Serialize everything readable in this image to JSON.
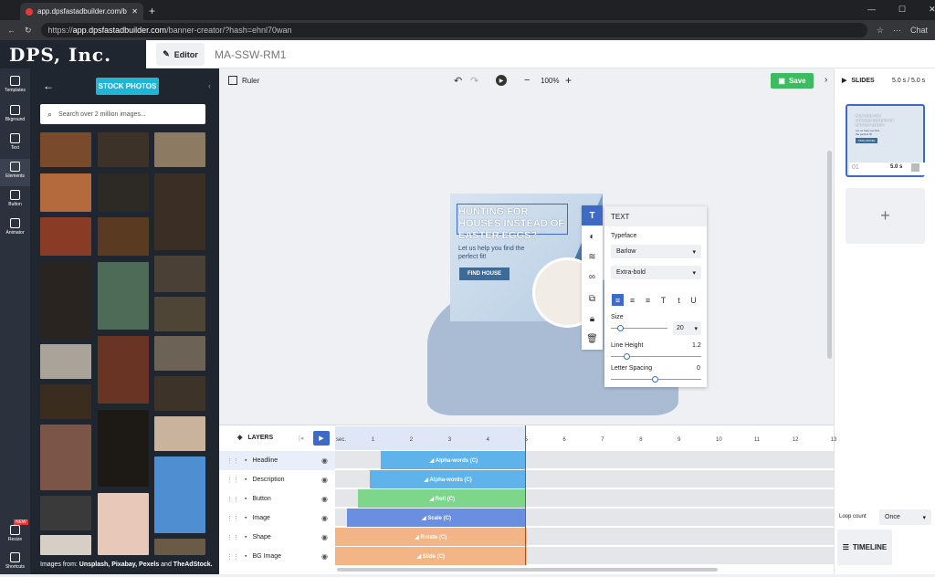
{
  "browser": {
    "tab_title": "app.dpsfastadbuilder.com/banner-",
    "url_prefix": "https://",
    "url_host": "app.dpsfastadbuilder.com",
    "url_path": "/banner-creator/?hash=ehnl70wan",
    "chat_label": "Chat"
  },
  "header": {
    "logo_text": "DPS, Inc.",
    "editor_label": "Editor",
    "doc_name": "MA-SSW-RM1"
  },
  "rail": {
    "items": [
      "Templates",
      "Bkground",
      "Text",
      "Elements",
      "Button",
      "Animator",
      "Resize",
      "Shortcuts"
    ],
    "new_badge": "NEW"
  },
  "panel": {
    "stock_button": "STOCK PHOTOS",
    "search_placeholder": "Search over 2 million images...",
    "credits_prefix": "Images from: ",
    "credits_sources": "Unsplash, Pixabay, Pexels",
    "credits_and": " and ",
    "credits_last": "TheAdStock."
  },
  "toolbar": {
    "ruler_label": "Ruler",
    "zoom": "100%",
    "save_label": "Save"
  },
  "banner": {
    "headline": "HUNTING FOR HOUSES INSTEAD OF EASTER EGGS?",
    "description": "Let us help you find the perfect fit!",
    "button": "FIND HOUSE"
  },
  "text_panel": {
    "title": "TEXT",
    "typeface_label": "Typeface",
    "typeface": "Barlow",
    "weight": "Extra-bold",
    "size_label": "Size",
    "size_value": "20",
    "line_height_label": "Line Height",
    "line_height_value": "1.2",
    "letter_spacing_label": "Letter Spacing",
    "letter_spacing_value": "0"
  },
  "slides": {
    "title": "SLIDES",
    "duration": "5.0 s / 5.0 s",
    "slide_number": "01",
    "slide_duration": "5.0 s",
    "thumb_headline": "HUNTING FOR HOUSES INSTEAD OF EASTER EGGS?",
    "thumb_desc": "Let us help you find the perfect fit!",
    "thumb_button": "FIND HOUSE",
    "add_symbol": "+",
    "loop_label": "Loop count",
    "loop_value": "Once",
    "timeline_button": "TIMELINE"
  },
  "timeline": {
    "layers_label": "LAYERS",
    "ruler_ticks": [
      "sec.",
      "1",
      "2",
      "3",
      "4",
      "5",
      "6",
      "7",
      "8",
      "9",
      "10",
      "11",
      "12",
      "13"
    ],
    "layers": [
      {
        "name": "Headline",
        "anim": "Alpha-words (C)",
        "color": "#5db3ea",
        "start": 1.2,
        "end": 5.0
      },
      {
        "name": "Description",
        "anim": "Alpha-words (C)",
        "color": "#5db3ea",
        "start": 0.9,
        "end": 5.0
      },
      {
        "name": "Button",
        "anim": "Roll (C)",
        "color": "#7dd68a",
        "start": 0.6,
        "end": 5.0
      },
      {
        "name": "Image",
        "anim": "Scale (C)",
        "color": "#6b8fe0",
        "start": 0.3,
        "end": 5.0
      },
      {
        "name": "Shape",
        "anim": "Rotate (C)",
        "color": "#f3b585",
        "start": 0.0,
        "end": 5.0
      },
      {
        "name": "BG Image",
        "anim": "Slide (C)",
        "color": "#f3b585",
        "start": 0.0,
        "end": 5.0
      }
    ]
  }
}
